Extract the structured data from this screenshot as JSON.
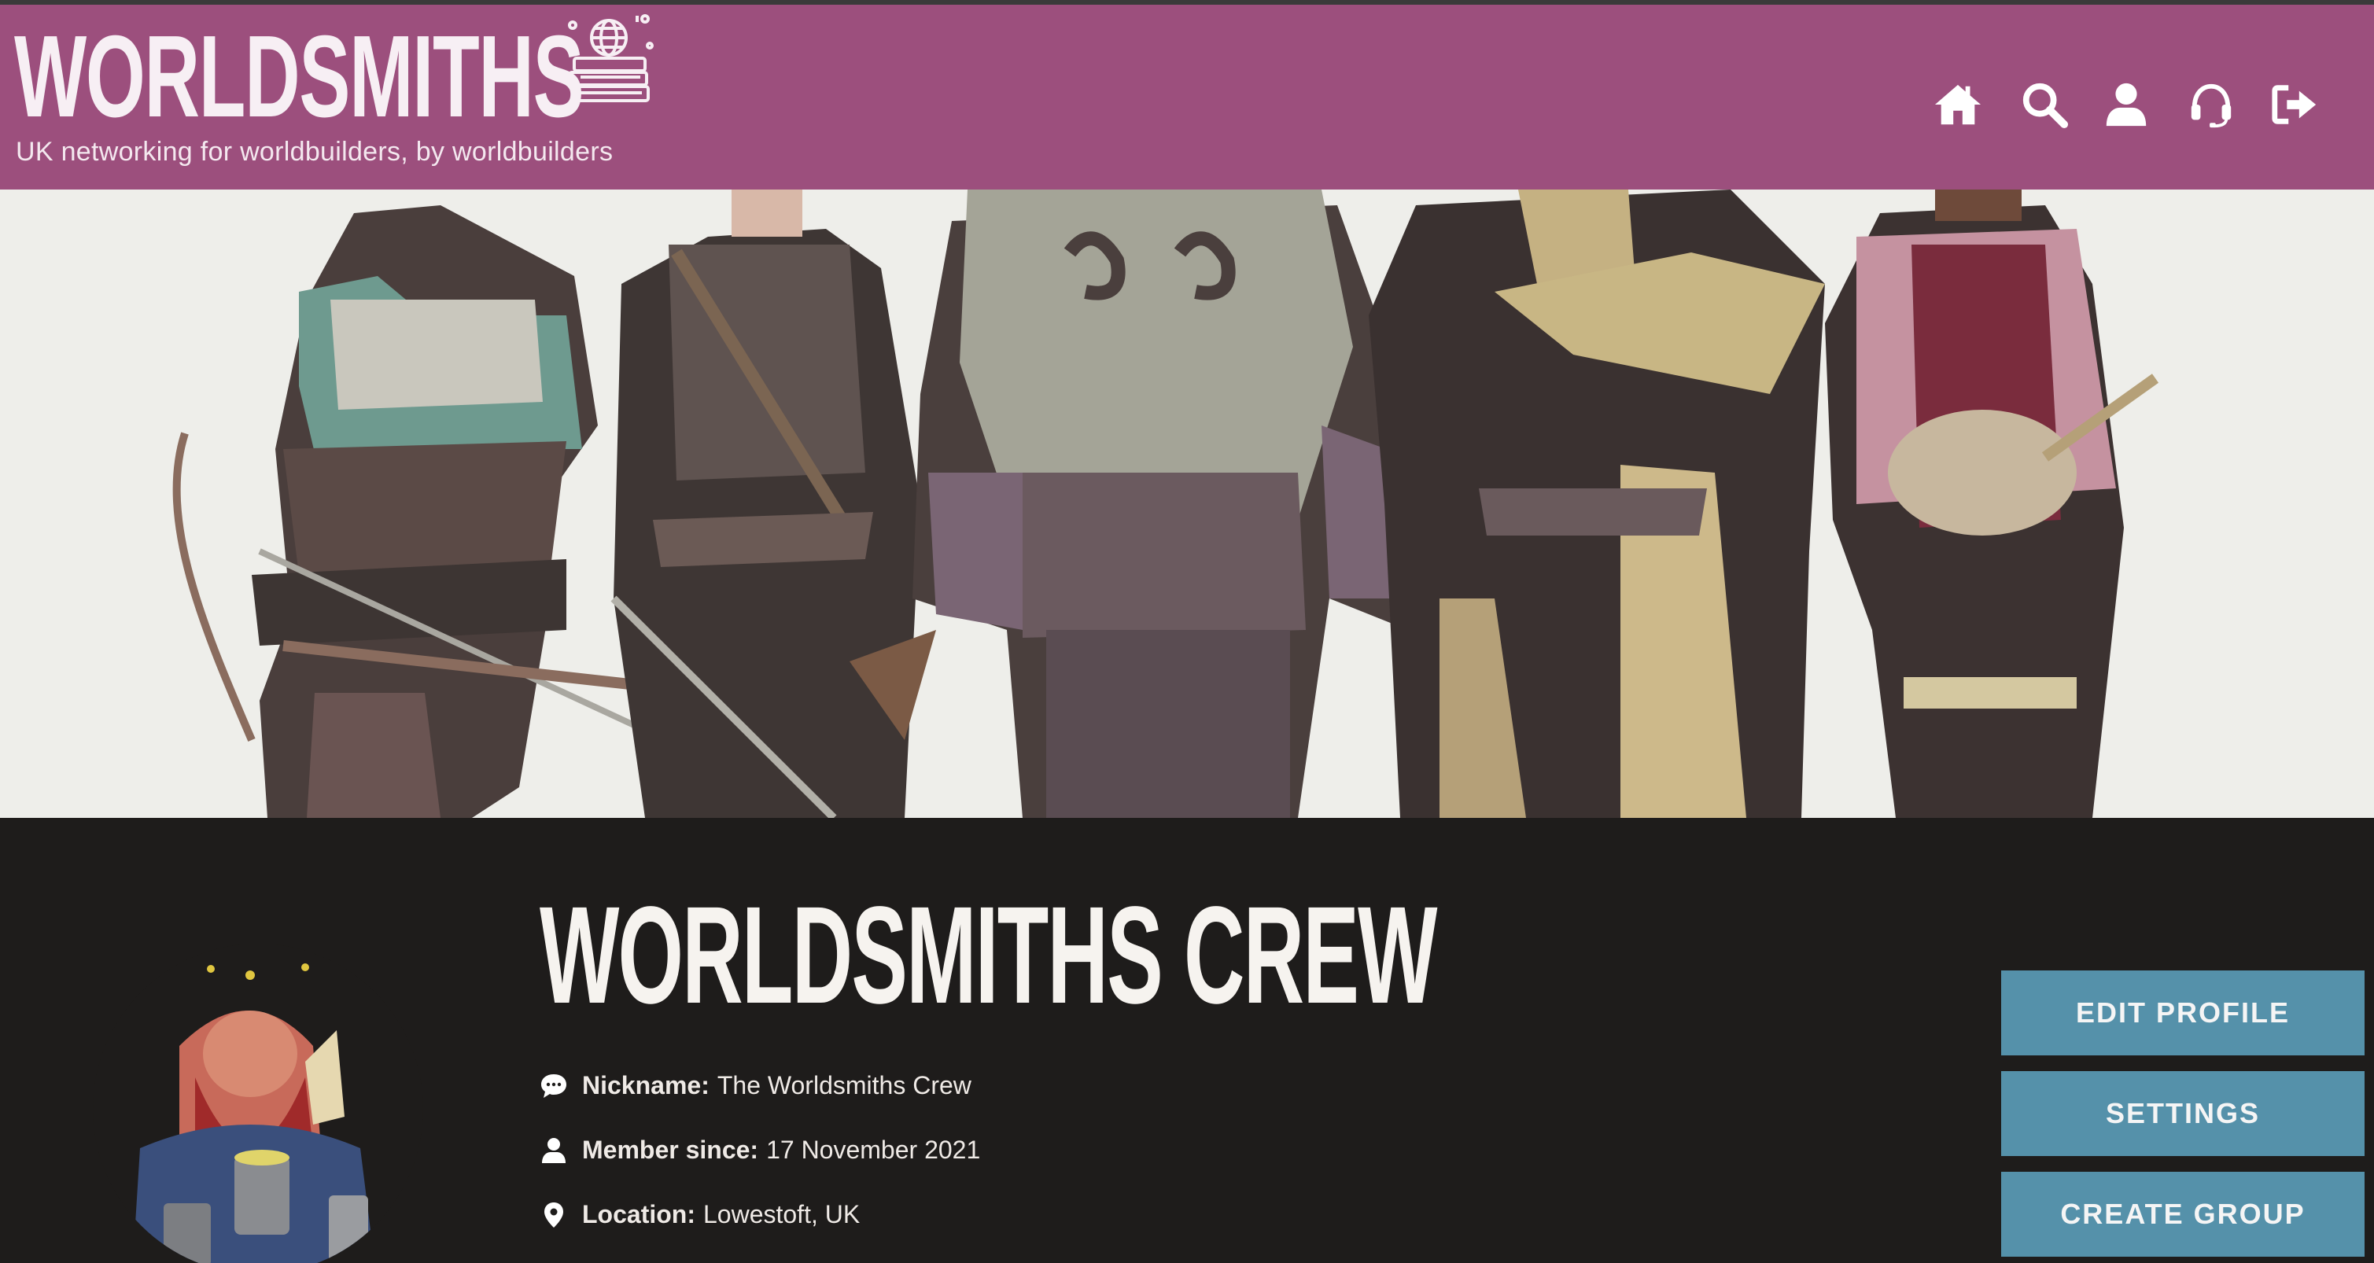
{
  "header": {
    "logo_text": "WORLDSMITHS",
    "tagline": "UK networking for worldbuilders, by worldbuilders",
    "nav": [
      {
        "icon": "home-icon"
      },
      {
        "icon": "search-icon"
      },
      {
        "icon": "user-icon"
      },
      {
        "icon": "support-headset-icon"
      },
      {
        "icon": "logout-icon"
      }
    ],
    "bg_color": "#9c4f7d"
  },
  "profile": {
    "name": "WORLDSMITHS CREW",
    "nickname_label": "Nickname:",
    "nickname": "The Worldsmiths Crew",
    "member_since_label": "Member since:",
    "member_since": "17 November 2021",
    "location_label": "Location:",
    "location": "Lowestoft, UK"
  },
  "actions": {
    "edit_profile": "EDIT PROFILE",
    "settings": "SETTINGS",
    "create_group": "CREATE GROUP",
    "button_color": "#5591aa"
  }
}
